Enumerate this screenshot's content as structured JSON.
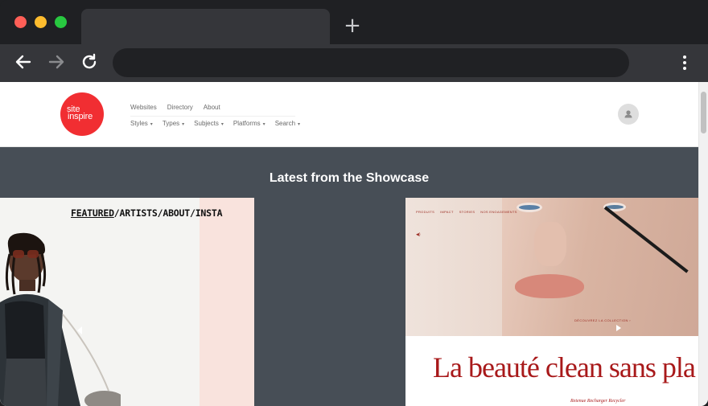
{
  "browser": {
    "controls": [
      "close",
      "minimize",
      "maximize"
    ],
    "new_tab_label": "+",
    "icons": [
      "back-icon",
      "forward-icon",
      "reload-icon",
      "menu-icon"
    ]
  },
  "site": {
    "logo": {
      "line1": "site",
      "line2": "inspire"
    },
    "nav_primary": [
      "Websites",
      "Directory",
      "About"
    ],
    "nav_secondary": [
      "Styles",
      "Types",
      "Subjects",
      "Platforms",
      "Search"
    ],
    "caret": "▾"
  },
  "showcase": {
    "title": "Latest from the Showcase",
    "left_card": {
      "nav": [
        "FEATURED",
        "/",
        "ARTISTS",
        "/",
        "ABOUT",
        "/",
        "INSTA"
      ]
    },
    "right_card": {
      "nav": [
        "PRODUITS",
        "IMPACT",
        "STORIES",
        "NOS ENGAGEMENTS"
      ],
      "sound": "◀)",
      "cta": "DÉCOUVREZ LA COLLECTION ›",
      "headline": "La beauté clean sans pla",
      "subline": "Retenue Recharger Recycler"
    }
  },
  "colors": {
    "logo": "#f12e32",
    "showcase_bg": "#474e56",
    "accent_red": "#a8191a"
  }
}
